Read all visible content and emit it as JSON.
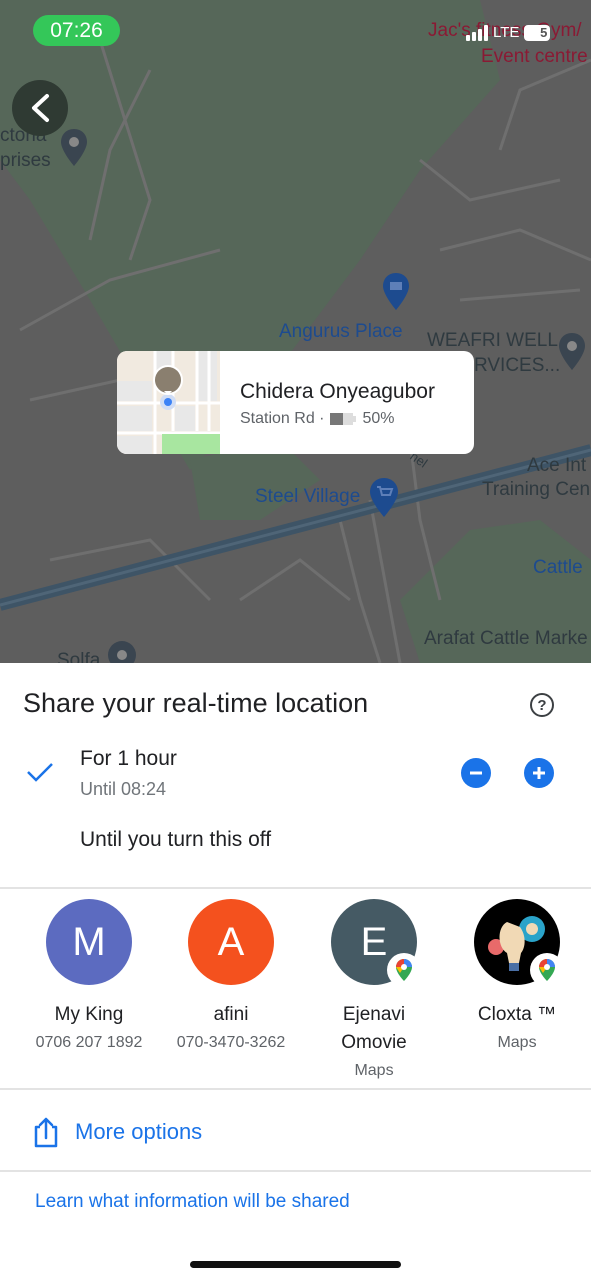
{
  "status_bar": {
    "time": "07:26",
    "network": "LTE",
    "battery": "5"
  },
  "map": {
    "labels": {
      "jacs_gym_line1": "Jac's fitness Gym/",
      "jacs_gym_line2": "Event centre",
      "victoria_line1": "ctoria",
      "victoria_line2": "prises",
      "angurus_place": "Angurus Place",
      "weafri_line1": "WEAFRI WELL",
      "weafri_line2": "RVICES...",
      "channel": "nel",
      "ace_line1": "Ace Int",
      "ace_line2": "Training Cen",
      "steel_village": "Steel Village",
      "cattle": "Cattle",
      "arafat": "Arafat Cattle Marke",
      "solfa": "Solfa"
    }
  },
  "location_card": {
    "name": "Chidera Onyeagubor",
    "street": "Station Rd ·",
    "battery_percent": "50%",
    "battery_level": 0.5
  },
  "sheet": {
    "title": "Share your real-time location",
    "duration_option": {
      "title": "For 1 hour",
      "subtitle": "Until 08:24",
      "selected": true
    },
    "indefinite_option": "Until you turn this off",
    "contacts": [
      {
        "initial": "M",
        "name": "My King",
        "sub": "0706 207 1892",
        "color": "#5c6bc0",
        "maps_badge": false
      },
      {
        "initial": "A",
        "name": "afini",
        "sub": "070-3470-3262",
        "color": "#f4511e",
        "maps_badge": false
      },
      {
        "initial": "E",
        "name": "Ejenavi Omovie",
        "sub": "Maps",
        "color": "#455a64",
        "maps_badge": true
      },
      {
        "initial": "",
        "name": "Cloxta ™",
        "sub": "Maps",
        "color": "#000000",
        "maps_badge": true
      }
    ],
    "more_options": "More options",
    "learn_link": "Learn what information will be shared"
  },
  "colors": {
    "accent": "#1a73e8",
    "status_green": "#34c759"
  }
}
